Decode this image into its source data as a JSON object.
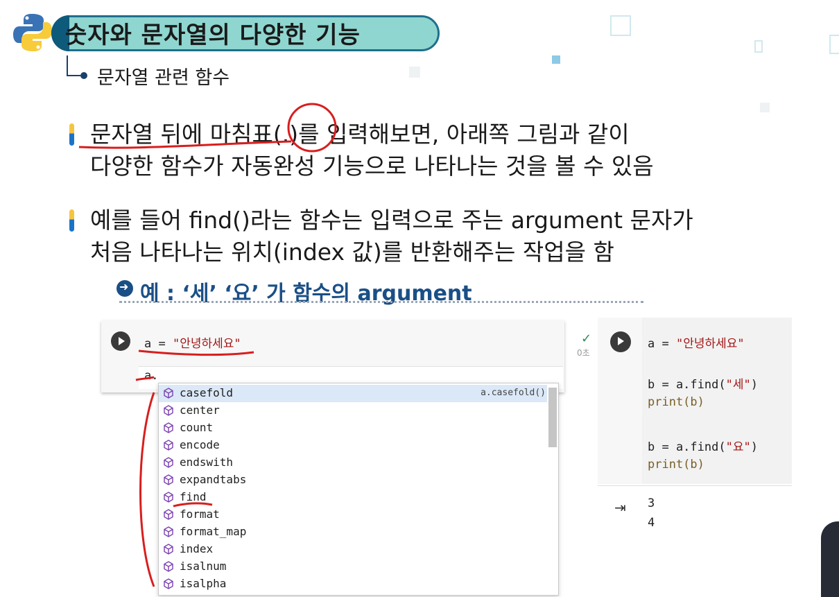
{
  "header": {
    "title": "숫자와 문자열의 다양한 기능",
    "subtitle": "문자열 관련 함수"
  },
  "bullets": [
    {
      "line1": "문자열 뒤에 마침표(.)를 입력해보면, 아래쪽 그림과 같이",
      "line2": "다양한 함수가 자동완성 기능으로 나타나는 것을 볼 수 있음"
    },
    {
      "line1": "예를 들어 find()라는 함수는 입력으로 주는 argument 문자가",
      "line2": "처음 나타나는 위치(index 값)를 반환해주는 작업을 함"
    }
  ],
  "example": "예 : ‘세’ ‘요’ 가 함수의 argument",
  "left_cell": {
    "code_var": "a = ",
    "code_str": "\"안녕하세요\"",
    "input": "a."
  },
  "autocomplete": {
    "hint": "a.casefold()",
    "items": [
      "casefold",
      "center",
      "count",
      "encode",
      "endswith",
      "expandtabs",
      "find",
      "format",
      "format_map",
      "index",
      "isalnum",
      "isalpha"
    ]
  },
  "right_cell": {
    "line1_var": "a = ",
    "line1_str": "\"안녕하세요\"",
    "line2_var": "b = a.find(",
    "line2_str": "\"세\"",
    "line2_end": ")",
    "line3": "print(b)",
    "line4_var": "b = a.find(",
    "line4_str": "\"요\"",
    "line4_end": ")",
    "line5": "print(b)",
    "outputs": [
      "3",
      "4"
    ],
    "elapsed": "0초"
  },
  "icons": {
    "logo": "python-logo-icon",
    "run": "play-icon",
    "method": "cube-icon",
    "output": "output-redirect-icon",
    "done": "check-icon"
  },
  "colors": {
    "title_fill": "#8fd6d0",
    "title_border": "#1f6f8b",
    "annotation": "#d81e1e",
    "string": "#a31515",
    "example_text": "#1a4f86"
  }
}
